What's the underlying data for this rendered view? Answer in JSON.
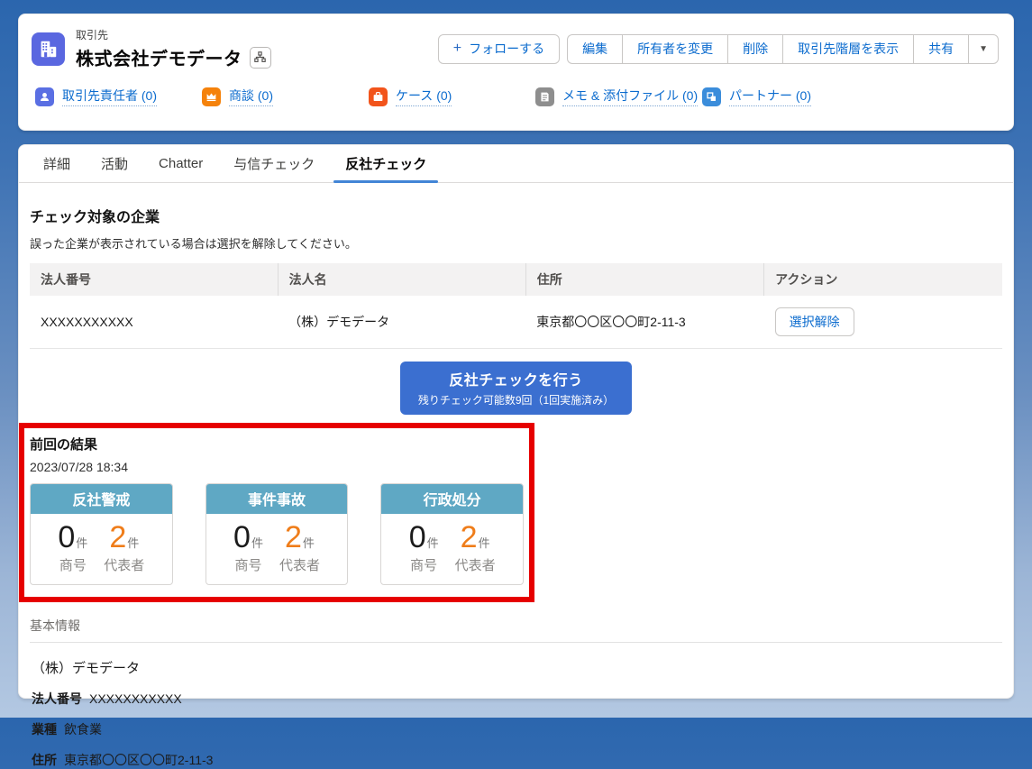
{
  "header": {
    "object_label": "取引先",
    "title": "株式会社デモデータ",
    "follow_plus": "+",
    "follow_label": "フォローする",
    "actions": [
      "編集",
      "所有者を変更",
      "削除",
      "取引先階層を表示",
      "共有"
    ],
    "more_icon": "▼",
    "related_links": [
      {
        "label": "取引先責任者 (0)",
        "icon": "contact-icon",
        "icon_color": "#5a6fe3"
      },
      {
        "label": "商談 (0)",
        "icon": "opportunity-icon",
        "icon_color": "#f5820b"
      },
      {
        "label": "ケース (0)",
        "icon": "case-icon",
        "icon_color": "#f2541b"
      },
      {
        "label": "メモ & 添付ファイル (0)",
        "icon": "note-icon",
        "icon_color": "#8e8e8e"
      },
      {
        "label": "パートナー (0)",
        "icon": "partner-icon",
        "icon_color": "#3b8ddb"
      }
    ]
  },
  "tabs": [
    "詳細",
    "活動",
    "Chatter",
    "与信チェック",
    "反社チェック"
  ],
  "active_tab": "反社チェック",
  "check_section": {
    "heading": "チェック対象の企業",
    "description": "誤った企業が表示されている場合は選択を解除してください。",
    "table": {
      "headers": [
        "法人番号",
        "法人名",
        "住所",
        "アクション"
      ],
      "rows": [
        {
          "corporate_number": "XXXXXXXXXXX",
          "name": "（株）デモデータ",
          "address": "東京都〇〇区〇〇町2-11-3",
          "action": "選択解除"
        }
      ]
    },
    "run_button": {
      "line1": "反社チェックを行う",
      "line2": "残りチェック可能数9回（1回実施済み）"
    }
  },
  "previous_result": {
    "heading": "前回の結果",
    "timestamp": "2023/07/28 18:34",
    "cards": [
      {
        "title": "反社警戒",
        "stats": [
          {
            "count": "0",
            "unit": "件",
            "label": "商号"
          },
          {
            "count": "2",
            "unit": "件",
            "label": "代表者"
          }
        ]
      },
      {
        "title": "事件事故",
        "stats": [
          {
            "count": "0",
            "unit": "件",
            "label": "商号"
          },
          {
            "count": "2",
            "unit": "件",
            "label": "代表者"
          }
        ]
      },
      {
        "title": "行政処分",
        "stats": [
          {
            "count": "0",
            "unit": "件",
            "label": "商号"
          },
          {
            "count": "2",
            "unit": "件",
            "label": "代表者"
          }
        ]
      }
    ]
  },
  "basic_info": {
    "heading": "基本情報",
    "company_name": "（株）デモデータ",
    "fields": [
      {
        "label": "法人番号",
        "value": "XXXXXXXXXXX"
      },
      {
        "label": "業種",
        "value": "飲食業"
      },
      {
        "label": "住所",
        "value": "東京都〇〇区〇〇町2-11-3"
      }
    ]
  },
  "colors": {
    "page_background_top": "#2b66ae",
    "page_background_bottom": "#b3c8e2",
    "account_icon": "#5a67e0",
    "link_blue": "#0b6bce",
    "run_button_blue": "#3b6fd0",
    "result_card_header_teal": "#5fa8c4",
    "alert_orange": "#ef7d1a",
    "highlight_red": "#e60000"
  }
}
